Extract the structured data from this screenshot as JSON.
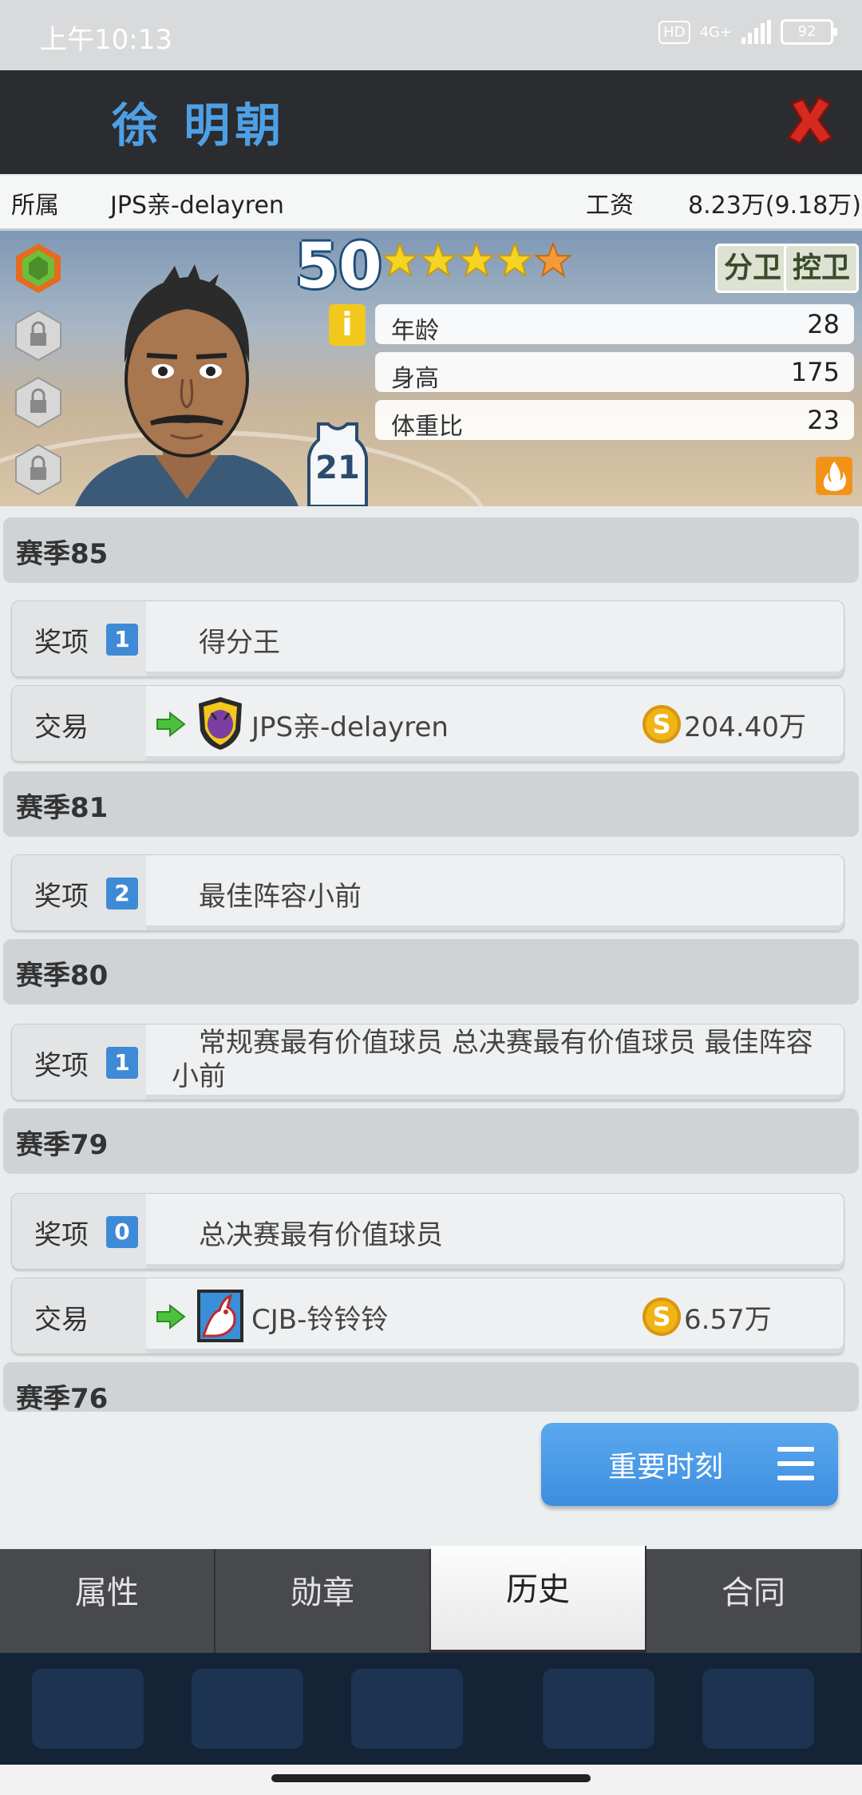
{
  "status_bar": {
    "time": "上午10:13",
    "hd": "HD",
    "network": "4G+",
    "battery": "92"
  },
  "header": {
    "player_name": "徐 明朝"
  },
  "info": {
    "team_label": "所属",
    "team_value": "JPS亲-delayren",
    "salary_label": "工资",
    "salary_value": "8.23万(9.18万)"
  },
  "card": {
    "rating": "50",
    "stars": 5,
    "positions": [
      "分卫",
      "控卫"
    ],
    "info_icon": "i",
    "stats": [
      {
        "label": "年龄",
        "value": "28"
      },
      {
        "label": "身高",
        "value": "175"
      },
      {
        "label": "体重比",
        "value": "23"
      }
    ],
    "jersey_number": "21"
  },
  "history": {
    "seasons": [
      {
        "title": "赛季85"
      },
      {
        "title": "赛季81"
      },
      {
        "title": "赛季80"
      },
      {
        "title": "赛季79"
      },
      {
        "title": "赛季76"
      }
    ],
    "rows": [
      {
        "type": "奖项",
        "count": "1",
        "text": "得分王"
      },
      {
        "type": "交易",
        "team": "JPS亲-delayren",
        "amount": "204.40万"
      },
      {
        "type": "奖项",
        "count": "2",
        "text": "最佳阵容小前"
      },
      {
        "type": "奖项",
        "count": "1",
        "text": "常规赛最有价值球员  总决赛最有价值球员  最佳阵容小前"
      },
      {
        "type": "奖项",
        "count": "0",
        "text": "总决赛最有价值球员"
      },
      {
        "type": "交易",
        "team": "CJB-铃铃铃",
        "amount": "6.57万"
      }
    ]
  },
  "moments_button": "重要时刻",
  "tabs": [
    "属性",
    "勋章",
    "历史",
    "合同"
  ],
  "colors": {
    "accent": "#4ea0e6",
    "header_bg": "#2b2c30",
    "close_red": "#d42a20"
  }
}
